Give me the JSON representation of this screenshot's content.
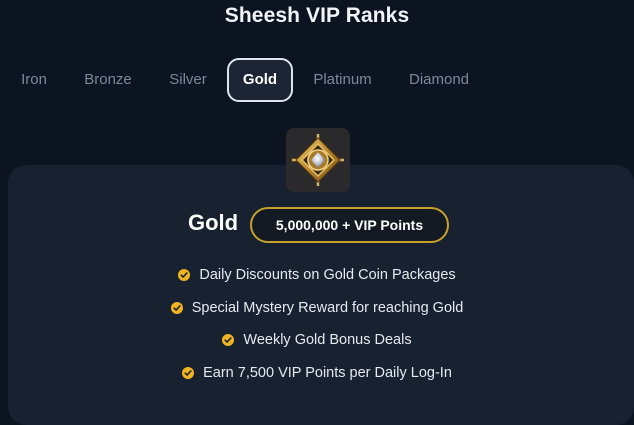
{
  "page": {
    "title": "Sheesh VIP Ranks"
  },
  "tabs": [
    {
      "label": "Iron",
      "active": false
    },
    {
      "label": "Bronze",
      "active": false
    },
    {
      "label": "Silver",
      "active": false
    },
    {
      "label": "Gold",
      "active": true
    },
    {
      "label": "Platinum",
      "active": false
    },
    {
      "label": "Diamond",
      "active": false
    }
  ],
  "rank": {
    "badge_icon": "gold-rank-badge-icon",
    "name": "Gold",
    "points": "5,000,000 + VIP Points",
    "benefits": [
      "Daily Discounts on Gold Coin Packages",
      "Special Mystery Reward for reaching Gold",
      "Weekly Gold Bonus Deals",
      "Earn 7,500 VIP Points per Daily Log-In"
    ]
  },
  "colors": {
    "background": "#0c1422",
    "card": "#172130",
    "accent_gold": "#c8a12a",
    "check": "#f0b421",
    "tab_inactive": "#7c8799"
  }
}
